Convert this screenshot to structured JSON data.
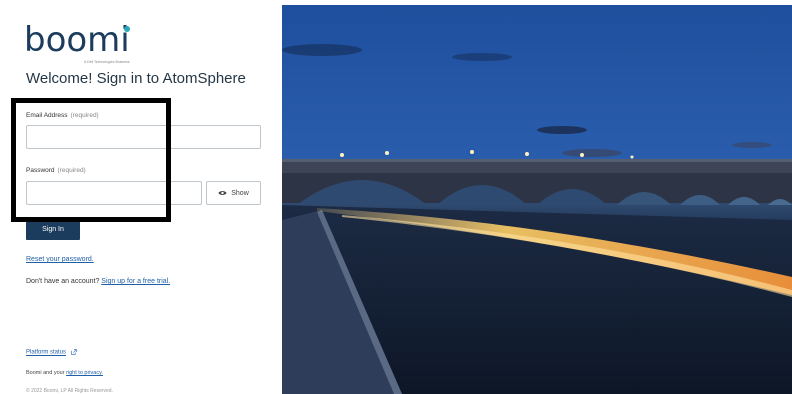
{
  "brand": {
    "logo_text": "boomi",
    "logo_tagline": "A Dell Technologies Business"
  },
  "signin": {
    "title": "Welcome! Sign in to AtomSphere",
    "email_label": "Email Address",
    "email_required": "(required)",
    "email_value": "",
    "password_label": "Password",
    "password_required": "(required)",
    "password_value": "",
    "show_label": "Show",
    "button_label": "Sign In"
  },
  "links": {
    "reset_password": "Reset your password.",
    "no_account": "Don't have an account?",
    "signup": "Sign up for a free trial.",
    "platform_status": "Platform status",
    "privacy_prefix": "Boomi and your",
    "privacy_link": "right to privacy."
  },
  "footer": {
    "copyright": "© 2022 Boomi, LP All Rights Reserved."
  },
  "colors": {
    "brand_navy": "#1b3c5c",
    "brand_teal": "#2aa7b8",
    "link_blue": "#1f5fa6",
    "highlight_box": "#000000"
  },
  "icons": [
    "eye-icon",
    "external-link-icon"
  ]
}
